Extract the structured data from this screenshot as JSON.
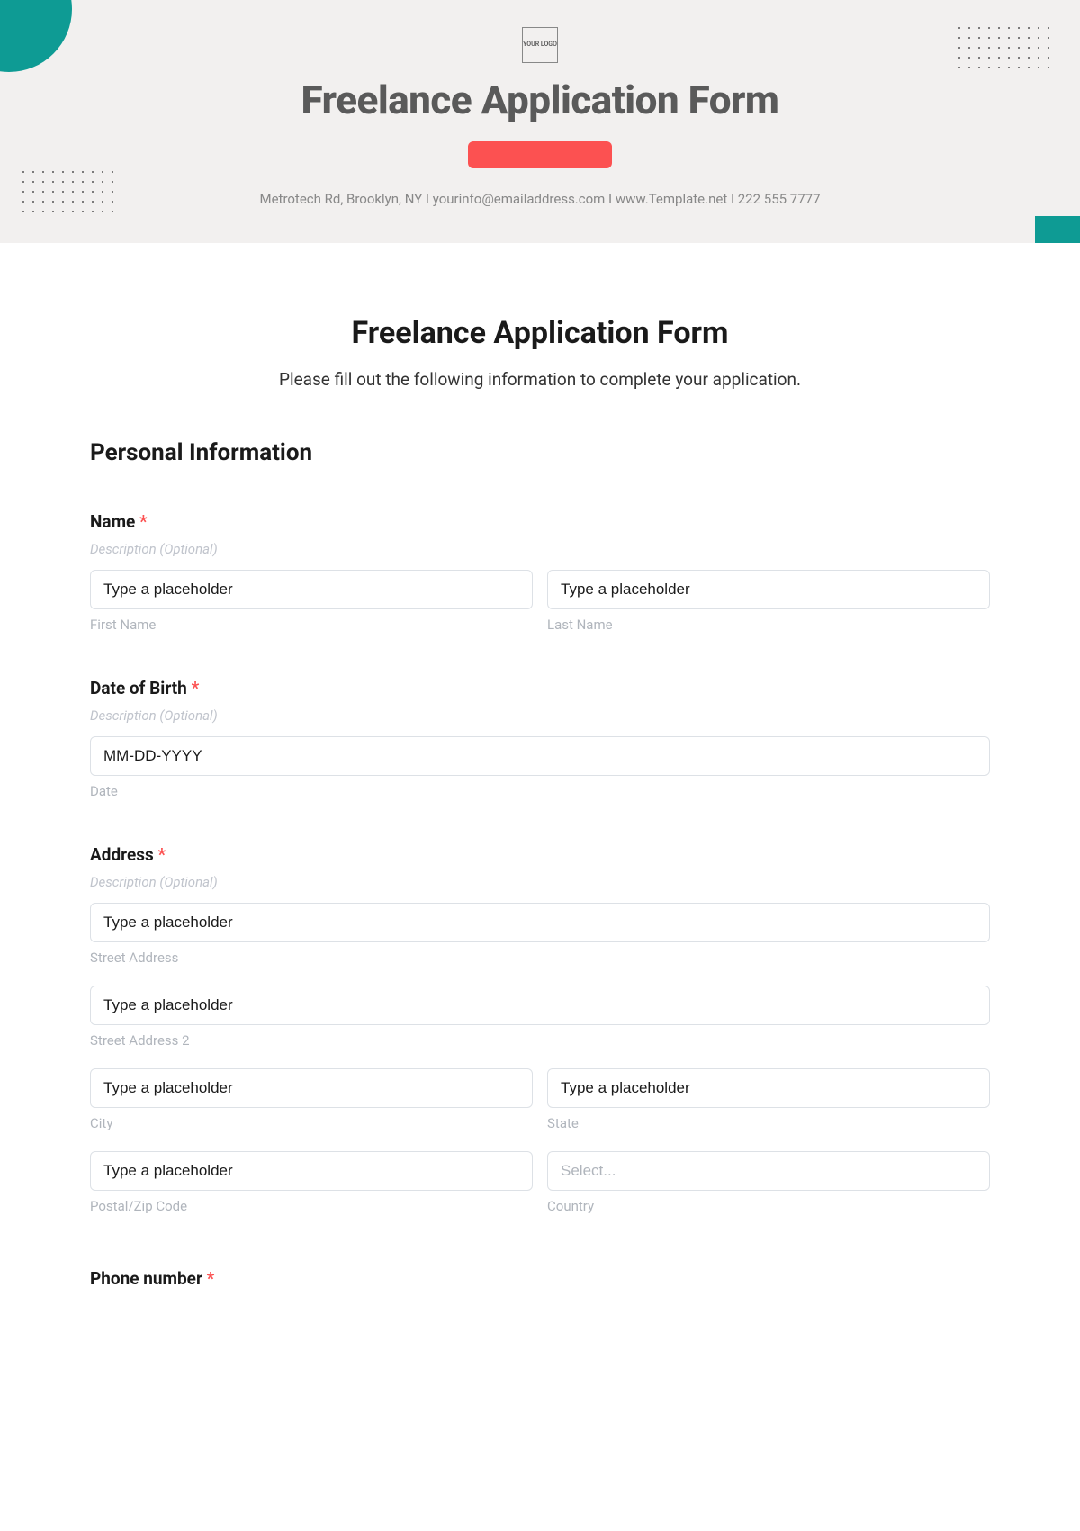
{
  "header": {
    "logo_text": "YOUR LOGO",
    "title": "Freelance Application Form",
    "contact": "Metrotech Rd, Brooklyn, NY  I  yourinfo@emailaddress.com  I  www.Template.net  I  222 555 7777"
  },
  "form": {
    "title": "Freelance Application Form",
    "subtitle": "Please fill out the following information to complete your application.",
    "section_personal": "Personal Information",
    "name": {
      "label": "Name",
      "desc": "Description (Optional)",
      "first_placeholder": "Type a placeholder",
      "first_sub": "First Name",
      "last_placeholder": "Type a placeholder",
      "last_sub": "Last Name"
    },
    "dob": {
      "label": "Date of Birth",
      "desc": "Description (Optional)",
      "placeholder": "MM-DD-YYYY",
      "sub": "Date"
    },
    "address": {
      "label": "Address",
      "desc": "Description (Optional)",
      "street1_placeholder": "Type a placeholder",
      "street1_sub": "Street Address",
      "street2_placeholder": "Type a placeholder",
      "street2_sub": "Street Address 2",
      "city_placeholder": "Type a placeholder",
      "city_sub": "City",
      "state_placeholder": "Type a placeholder",
      "state_sub": "State",
      "postal_placeholder": "Type a placeholder",
      "postal_sub": "Postal/Zip Code",
      "country_placeholder": "Select...",
      "country_sub": "Country"
    },
    "phone": {
      "label": "Phone number"
    }
  }
}
